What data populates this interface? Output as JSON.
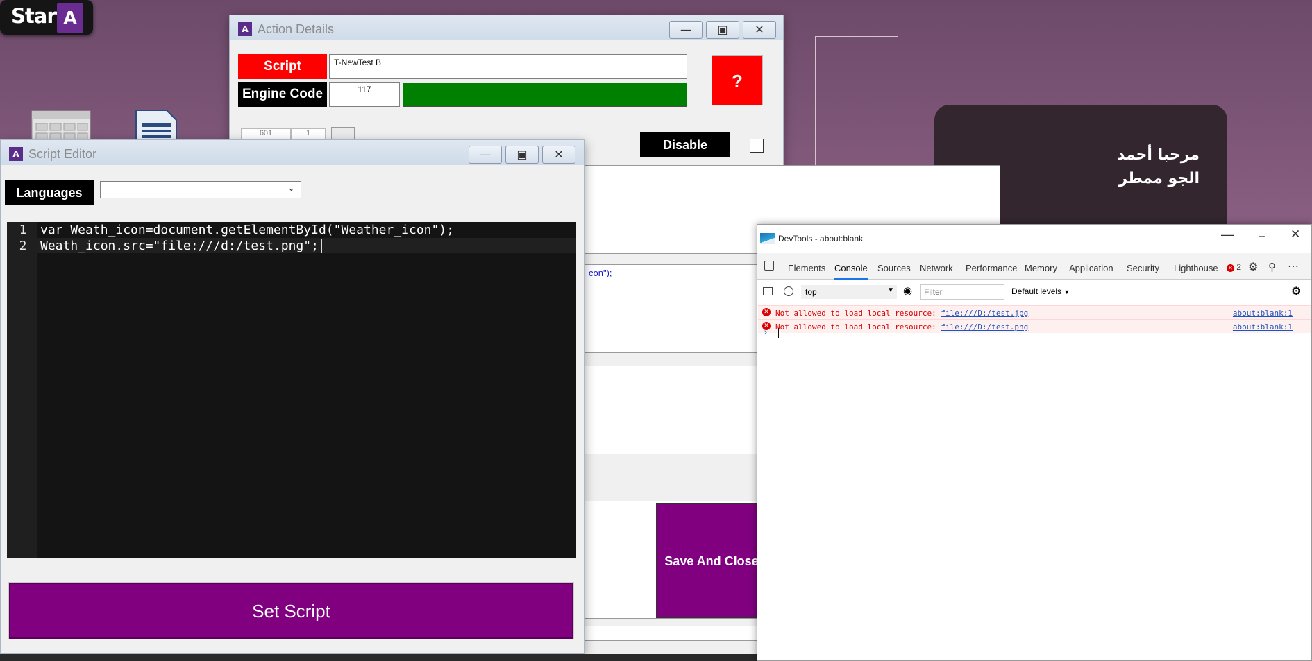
{
  "start_button": {
    "label": "Start",
    "logo_letter": "A"
  },
  "action_details": {
    "title": "Action Details",
    "script_label": "Script",
    "script_value": "T-NewTest B",
    "engine_code_label": "Engine Code",
    "engine_code_value": "117",
    "help_label": "?",
    "small_field_a": "601",
    "small_field_b": "1",
    "disable_label": "Disable",
    "partial_code_text": "con\");",
    "save_close_label": "Save And Close"
  },
  "script_editor": {
    "title": "Script Editor",
    "languages_label": "Languages",
    "language_selected": "",
    "lines": [
      {
        "num": "1",
        "text": "var Weath_icon=document.getElementById(\"Weather_icon\");"
      },
      {
        "num": "2",
        "text": "Weath_icon.src=\"file:///d:/test.png\";"
      }
    ],
    "set_script_label": "Set Script"
  },
  "welcome_card": {
    "line1": "مرحبا أحمد",
    "line2": "الجو ممطر"
  },
  "devtools": {
    "title": "DevTools - about:blank",
    "tabs": [
      "Elements",
      "Console",
      "Sources",
      "Network",
      "Performance",
      "Memory",
      "Application",
      "Security",
      "Lighthouse"
    ],
    "active_tab": "Console",
    "error_count": "2",
    "context": "top",
    "filter_placeholder": "Filter",
    "levels": "Default levels",
    "errors": [
      {
        "message": "Not allowed to load local resource: ",
        "link": "file:///D:/test.jpg",
        "source": "about:blank:1"
      },
      {
        "message": "Not allowed to load local resource: ",
        "link": "file:///D:/test.png",
        "source": "about:blank:1"
      }
    ],
    "prompt": "›"
  },
  "colors": {
    "purple": "#800080",
    "red": "#ff0000",
    "green": "#008000",
    "editor_bg": "#141414"
  }
}
